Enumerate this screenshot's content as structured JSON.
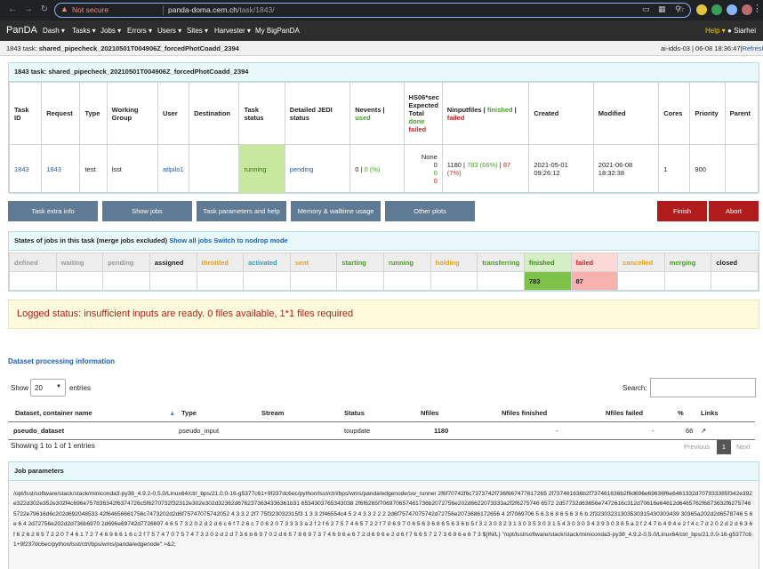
{
  "browser": {
    "not_secure": "Not secure",
    "url_host": "panda-doma.cern.ch",
    "url_path": "/task/1843/"
  },
  "nav": {
    "brand": "PanDA",
    "items": [
      "Dash",
      "Tasks",
      "Jobs",
      "Errors",
      "Users",
      "Sites",
      "Harvester",
      "My BigPanDA"
    ],
    "help": "Help",
    "user": "Siarhei"
  },
  "subheader": {
    "prefix": "1843 task:",
    "name": "shared_pipecheck_20210501T004906Z_forcedPhotCoadd_2394",
    "server": "ai-idds-03 | 06-08 18:36:47",
    "refresh": "Refresh"
  },
  "task_panel": {
    "title": "1843 task: shared_pipecheck_20210501T004906Z_forcedPhotCoadd_2394",
    "headers": {
      "task_id": "Task ID",
      "request": "Request",
      "type": "Type",
      "working_group": "Working Group",
      "user": "User",
      "destination": "Destination",
      "task_status": "Task status",
      "jedi_status": "Detailed JEDI status",
      "nevents": "Nevents |",
      "nevents_used": "used",
      "hs06_1": "HS06*sec Expected Total",
      "hs06_done": "done",
      "hs06_failed": "failed",
      "ninput": "Ninputfiles |",
      "ninput_finished": "finished",
      "ninput_failed": "failed",
      "created": "Created",
      "modified": "Modified",
      "cores": "Cores",
      "priority": "Priority",
      "parent": "Parent"
    },
    "row": {
      "task_id": "1843",
      "request": "1843",
      "type": "test",
      "working_group": "lsst",
      "user": "atlpilo1",
      "destination": "",
      "task_status": "running",
      "jedi_status": "pending",
      "nevents": "0 |",
      "nevents_used": "0 (%)",
      "hs06_none": "None",
      "hs06_total": "0",
      "hs06_done": "0",
      "hs06_failed": "0",
      "ninput_total": "1180 |",
      "ninput_finished": "783 (66%)",
      "ninput_sep": "|",
      "ninput_failed": "87 (7%)",
      "created_date": "2021-05-01",
      "created_time": "09:26:12",
      "modified_date": "2021-06-08",
      "modified_time": "18:32:38",
      "cores": "1",
      "priority": "900",
      "parent": ""
    }
  },
  "buttons": {
    "extra_info": "Task extra info",
    "show_jobs": "Show jobs",
    "params_help": "Task parameters and help",
    "memory": "Memory & walltime usage",
    "other_plots": "Other plots",
    "finish": "Finish",
    "abort": "Abort"
  },
  "states_panel": {
    "title": "States of jobs in this task (merge jobs excluded)",
    "show_all": "Show all jobs",
    "switch": "Switch to nodrop mode",
    "headers": [
      "defined",
      "waiting",
      "pending",
      "assigned",
      "throttled",
      "activated",
      "sent",
      "starting",
      "running",
      "holding",
      "transferring",
      "finished",
      "failed",
      "cancelled",
      "merging",
      "closed"
    ],
    "header_colors": [
      "#999999",
      "#999999",
      "#999999",
      "#222222",
      "#e8a020",
      "#3a9ab8",
      "#e8a020",
      "#4a9a2a",
      "#4a9a2a",
      "#e8a020",
      "#4a9a2a",
      "#3c8a1e",
      "#d32020",
      "#e8a020",
      "#4a9a2a",
      "#222222"
    ],
    "values": [
      "",
      "",
      "",
      "",
      "",
      "",
      "",
      "",
      "",
      "",
      "",
      "783",
      "87",
      "",
      "",
      ""
    ]
  },
  "logged_status": "Logged status: insufficient inputs are ready. 0 files available, 1*1 files required",
  "dataset_section": {
    "title": "Dataset processing information",
    "show": "Show",
    "page_size": "20",
    "entries": "entries",
    "search": "Search:",
    "headers": {
      "dataset": "Dataset, container name",
      "type": "Type",
      "stream": "Stream",
      "status": "Status",
      "nfiles": "Nfiles",
      "finished": "Nfiles finished",
      "failed": "Nfiles failed",
      "pct": "%",
      "links": "Links"
    },
    "row": {
      "dataset": "pseudo_dataset",
      "type": "pseudo_input",
      "stream": "",
      "status": "toupdate",
      "nfiles": "1180",
      "finished": "-",
      "failed": "-",
      "pct": "66"
    },
    "showing": "Showing 1 to 1 of 1 entries",
    "previous": "Previous",
    "page": "1",
    "next": "Next"
  },
  "job_params": {
    "title": "Job parameters",
    "text": "/opt/lsst/software/stack/stack/miniconda3-py38_4.9.2-0.5.0/Linux64/ctrl_bps/21.0.0-16-g5377c61+9f237dc6ec/python/lsst/ctrl/bps/wms/panda/edgenode/sw_runner 2f6f70742f6c7373742f736f667477617265 2f737461636b2f737461636b2f6d696e69636f6e6461332d707933385f342e392e322d302e352e302f4c696e757836342f6374726c5f6270732f32312e302e302d32362d6762373634336361b31 6534303765343038 2f6f6265f706970657461736b2072756e202d6622073333a2f2f6275746 6572 2d57732d63656e7472616c312d70616e64612d6465762f6873632f6275746 5722e79616d6c202d692048533 42f64656661756c7473202d2d6f75747075742052 4 3 3 2 2f7 75f323032315f3 1 3 3 2f46554c4 5 2 4 3 3 2 2 2 2d6f75747075742d72756e2073686172656 4 2f7069706 5 6 3 6 8 6 5 6 3 6 b 2f32303231303530315430303439 30365a202d2d6578746 5 6 e 6 4 2d72756e202d2d736b6970 2d696e69742d7726697 4 6 5 7 3 2 0 2 d 2 d 6 c 6 f 7 2 6 c 7 0 6 2 0 7 3 3 3 3 a 2 f 2 f 6 2 7 5 7 4 6 5 7 2 2 f 7 0 6 9 7 0 6 5 6 3 6 8 6 5 6 3 6 b 5 f 3 2 3 0 3 2 3 1 3 0 3 5 3 0 3 1 5 4 3 0 3 0 3 4 3 9 3 0 3 6 5 a 2 f 2 4 7 b 4 9 4 e 2 f 4 c 7 d 2 0 2 d 2 d 6 3 6 f 6 2 6 2 6 5 7 2 2 0 7 4 6 1 7 2 7 4 6 9 6 6 1 6 c 2 f 7 5 7 4 7 0 7 5 7 4 7 3 2 0 2 d 2 d 7 3 6 b 6 9 7 0 2 d 6 5 7 8 6 9 7 3 7 4 6 9 6 e 6 7 2 d 6 9 6 e 2 d 6 f 7 6 6 5 7 2 7 3 6 9 6 e 6 7 3 ${IN/L} \"/opt/lsst/software/stack/stack/miniconda3-py38_4.9.2-0.5.0/Linux64/ctrl_bps/21.0.0-16-g5377c61+9f237dc6ec/python/lsst/ctrl/bps/wms/panda/edgenode\" >&2;"
  }
}
